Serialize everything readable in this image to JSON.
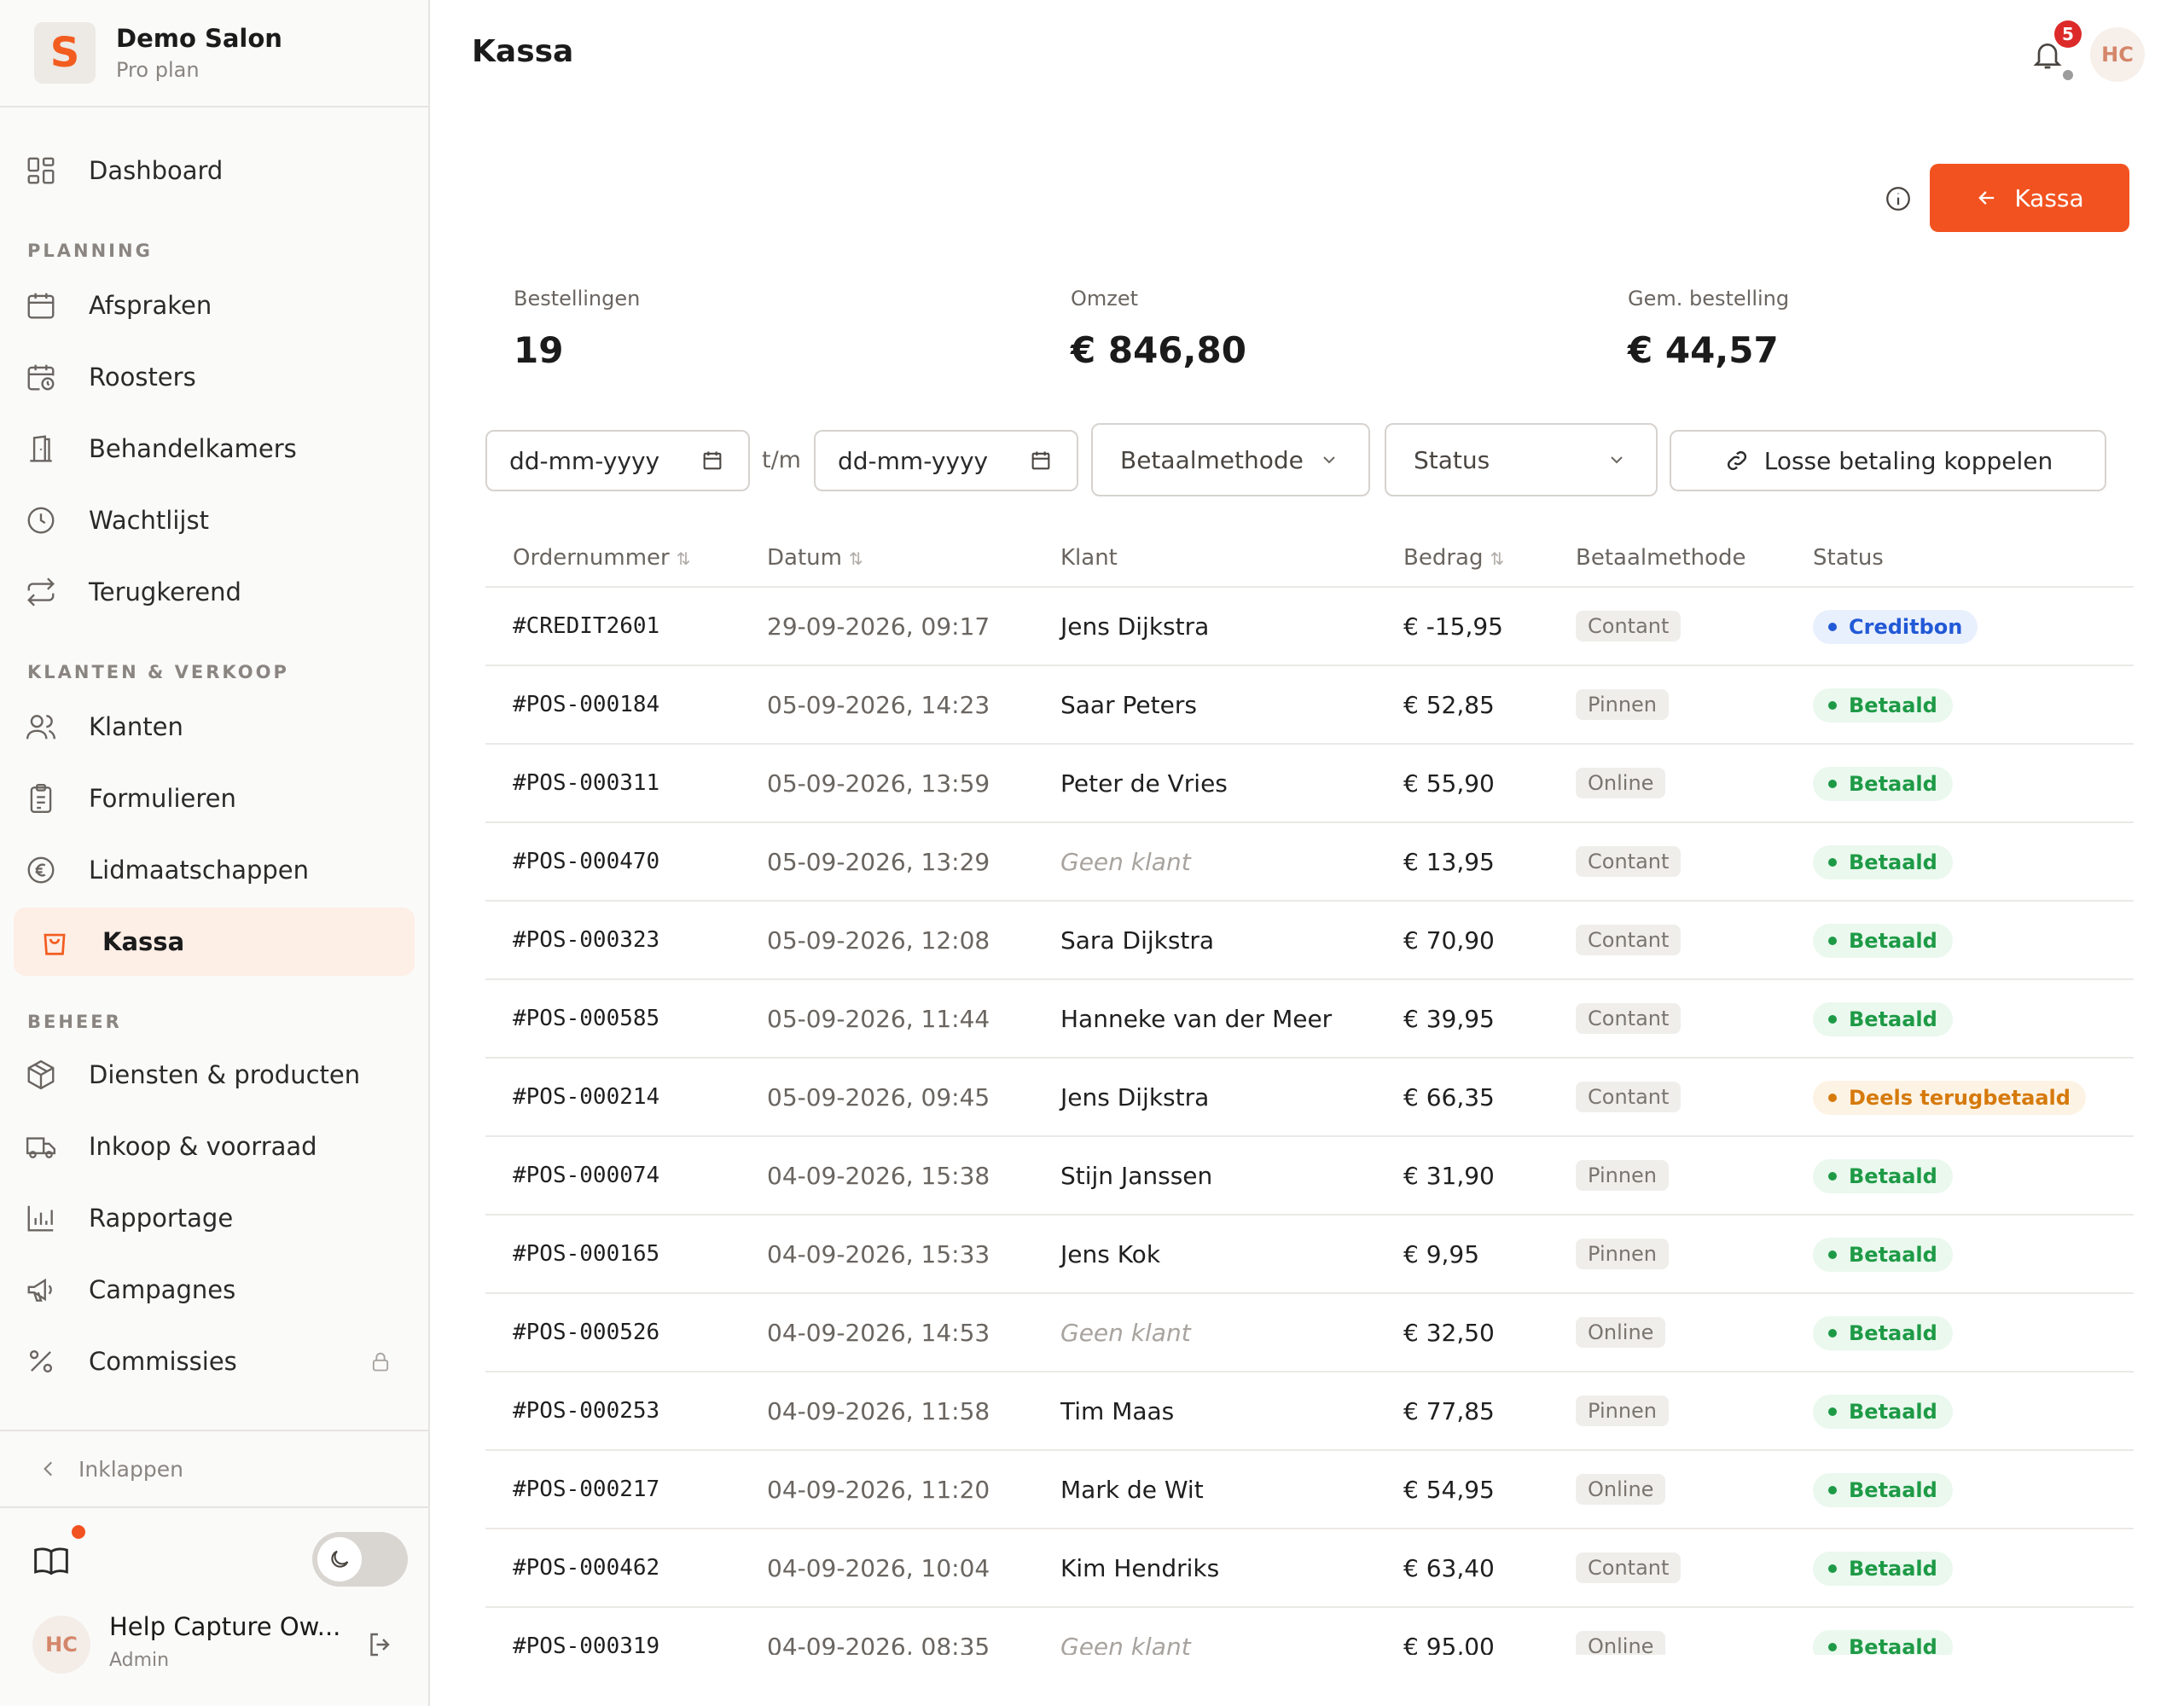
{
  "brand": {
    "logo_letter": "S",
    "name": "Demo Salon",
    "plan": "Pro plan"
  },
  "nav": {
    "dashboard": "Dashboard",
    "section_planning": "PLANNING",
    "afspraken": "Afspraken",
    "roosters": "Roosters",
    "behandelkamers": "Behandelkamers",
    "wachtlijst": "Wachtlijst",
    "terugkerend": "Terugkerend",
    "section_klanten": "KLANTEN & VERKOOP",
    "klanten": "Klanten",
    "formulieren": "Formulieren",
    "lidmaatschappen": "Lidmaatschappen",
    "kassa": "Kassa",
    "section_beheer": "BEHEER",
    "diensten": "Diensten & producten",
    "inkoop": "Inkoop & voorraad",
    "rapportage": "Rapportage",
    "campagnes": "Campagnes",
    "commissies": "Commissies",
    "collapse": "Inklappen"
  },
  "user": {
    "initials": "HC",
    "name": "Help Capture Ow...",
    "role": "Admin"
  },
  "header": {
    "title": "Kassa",
    "notification_count": "5",
    "avatar_initials": "HC"
  },
  "actions": {
    "kassa_button": "Kassa"
  },
  "stats": [
    {
      "label": "Bestellingen",
      "value": "19"
    },
    {
      "label": "Omzet",
      "value": "€ 846,80"
    },
    {
      "label": "Gem. bestelling",
      "value": "€ 44,57"
    }
  ],
  "filters": {
    "date_from_placeholder": "dd-mm-yyyy",
    "range_separator": "t/m",
    "date_to_placeholder": "dd-mm-yyyy",
    "payment_method": "Betaalmethode",
    "status": "Status",
    "link_payment": "Losse betaling koppelen"
  },
  "table": {
    "columns": [
      "Ordernummer",
      "Datum",
      "Klant",
      "Bedrag",
      "Betaalmethode",
      "Status"
    ],
    "sortable": [
      true,
      true,
      false,
      true,
      false,
      false
    ],
    "rows": [
      {
        "order": "#CREDIT2601",
        "date": "29-09-2026, 09:17",
        "client": "Jens Dijkstra",
        "no_client": false,
        "amount": "€ -15,95",
        "method": "Contant",
        "status": "Creditbon",
        "status_type": "credit"
      },
      {
        "order": "#POS-000184",
        "date": "05-09-2026, 14:23",
        "client": "Saar Peters",
        "no_client": false,
        "amount": "€ 52,85",
        "method": "Pinnen",
        "status": "Betaald",
        "status_type": "paid"
      },
      {
        "order": "#POS-000311",
        "date": "05-09-2026, 13:59",
        "client": "Peter de Vries",
        "no_client": false,
        "amount": "€ 55,90",
        "method": "Online",
        "status": "Betaald",
        "status_type": "paid"
      },
      {
        "order": "#POS-000470",
        "date": "05-09-2026, 13:29",
        "client": "Geen klant",
        "no_client": true,
        "amount": "€ 13,95",
        "method": "Contant",
        "status": "Betaald",
        "status_type": "paid"
      },
      {
        "order": "#POS-000323",
        "date": "05-09-2026, 12:08",
        "client": "Sara Dijkstra",
        "no_client": false,
        "amount": "€ 70,90",
        "method": "Contant",
        "status": "Betaald",
        "status_type": "paid"
      },
      {
        "order": "#POS-000585",
        "date": "05-09-2026, 11:44",
        "client": "Hanneke van der Meer",
        "no_client": false,
        "amount": "€ 39,95",
        "method": "Contant",
        "status": "Betaald",
        "status_type": "paid"
      },
      {
        "order": "#POS-000214",
        "date": "05-09-2026, 09:45",
        "client": "Jens Dijkstra",
        "no_client": false,
        "amount": "€ 66,35",
        "method": "Contant",
        "status": "Deels terugbetaald",
        "status_type": "partial"
      },
      {
        "order": "#POS-000074",
        "date": "04-09-2026, 15:38",
        "client": "Stijn Janssen",
        "no_client": false,
        "amount": "€ 31,90",
        "method": "Pinnen",
        "status": "Betaald",
        "status_type": "paid"
      },
      {
        "order": "#POS-000165",
        "date": "04-09-2026, 15:33",
        "client": "Jens Kok",
        "no_client": false,
        "amount": "€ 9,95",
        "method": "Pinnen",
        "status": "Betaald",
        "status_type": "paid"
      },
      {
        "order": "#POS-000526",
        "date": "04-09-2026, 14:53",
        "client": "Geen klant",
        "no_client": true,
        "amount": "€ 32,50",
        "method": "Online",
        "status": "Betaald",
        "status_type": "paid"
      },
      {
        "order": "#POS-000253",
        "date": "04-09-2026, 11:58",
        "client": "Tim Maas",
        "no_client": false,
        "amount": "€ 77,85",
        "method": "Pinnen",
        "status": "Betaald",
        "status_type": "paid"
      },
      {
        "order": "#POS-000217",
        "date": "04-09-2026, 11:20",
        "client": "Mark de Wit",
        "no_client": false,
        "amount": "€ 54,95",
        "method": "Online",
        "status": "Betaald",
        "status_type": "paid"
      },
      {
        "order": "#POS-000462",
        "date": "04-09-2026, 10:04",
        "client": "Kim Hendriks",
        "no_client": false,
        "amount": "€ 63,40",
        "method": "Contant",
        "status": "Betaald",
        "status_type": "paid"
      },
      {
        "order": "#POS-000319",
        "date": "04-09-2026, 08:35",
        "client": "Geen klant",
        "no_client": true,
        "amount": "€ 95,00",
        "method": "Online",
        "status": "Betaald",
        "status_type": "paid"
      }
    ]
  },
  "colors": {
    "accent": "#f2521f",
    "paid": "#1e9a46",
    "credit": "#2259d6",
    "partial": "#d67a0c",
    "badge": "#dc2a2a"
  }
}
